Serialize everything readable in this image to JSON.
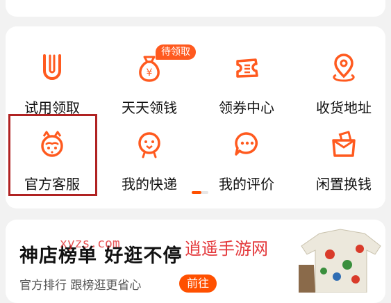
{
  "colors": {
    "accent": "#ff5000",
    "icon": "#ff5a1f",
    "highlight": "#b02222",
    "watermark": "#e4393c"
  },
  "grid": {
    "badge": "待领取",
    "items": [
      {
        "label": "试用领取",
        "icon": "trial-u-icon"
      },
      {
        "label": "天天领钱",
        "icon": "money-bag-icon"
      },
      {
        "label": "领券中心",
        "icon": "coupon-icon"
      },
      {
        "label": "收货地址",
        "icon": "location-pin-icon"
      },
      {
        "label": "官方客服",
        "icon": "customer-service-icon"
      },
      {
        "label": "我的快递",
        "icon": "express-bird-icon"
      },
      {
        "label": "我的评价",
        "icon": "chat-bubble-icon"
      },
      {
        "label": "闲置换钱",
        "icon": "idle-box-icon"
      }
    ]
  },
  "promo": {
    "title": "神店榜单 好逛不停",
    "subtitle": "官方排行 跟榜逛更省心",
    "button": "前往"
  },
  "watermark": {
    "site": "xyzs.com",
    "text": "逍遥手游网"
  }
}
